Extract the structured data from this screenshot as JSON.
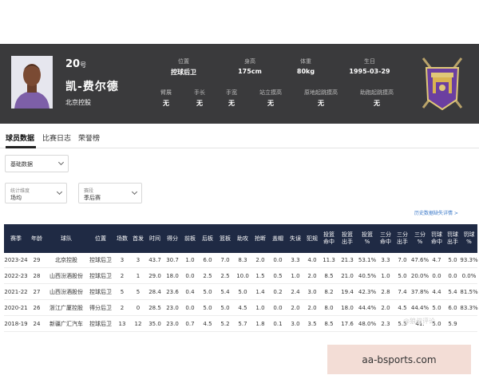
{
  "player": {
    "number": "20",
    "number_suffix": "号",
    "name": "凯-费尔德",
    "team": "北京控股",
    "info_row1": [
      {
        "label": "位置",
        "value": "控球后卫"
      },
      {
        "label": "身高",
        "value": "175cm"
      },
      {
        "label": "体重",
        "value": "80kg"
      },
      {
        "label": "生日",
        "value": "1995-03-29"
      }
    ],
    "info_row2": [
      {
        "label": "臂展",
        "value": "无"
      },
      {
        "label": "手长",
        "value": "无"
      },
      {
        "label": "手宽",
        "value": "无"
      },
      {
        "label": "站立摸高",
        "value": "无"
      },
      {
        "label": "原地起跳摸高",
        "value": "无"
      },
      {
        "label": "助跑起跳摸高",
        "value": "无"
      }
    ]
  },
  "tabs": [
    {
      "label": "球员数据",
      "active": true
    },
    {
      "label": "比赛日志",
      "active": false
    },
    {
      "label": "荣誉榜",
      "active": false
    }
  ],
  "filters": {
    "data_type": {
      "value": "基础数据"
    },
    "stat_dim": {
      "label": "统计维度",
      "value": "场均"
    },
    "season_type": {
      "label": "赛段",
      "value": "季后赛"
    }
  },
  "history_link": "历史数据缺失详情 >",
  "table": {
    "headers": [
      "赛季",
      "年龄",
      "球队",
      "位置",
      "场数",
      "首发",
      "时间",
      "得分",
      "前板",
      "后板",
      "篮板",
      "助攻",
      "抢断",
      "盖帽",
      "失误",
      "犯规",
      "投篮\n命中",
      "投篮\n出手",
      "投篮\n%",
      "三分\n命中",
      "三分\n出手",
      "三分\n%",
      "罚球\n命中",
      "罚球\n出手",
      "罚球\n%"
    ],
    "rows": [
      [
        "2023-24",
        "29",
        "北京控股",
        "控球后卫",
        "3",
        "3",
        "43.7",
        "30.7",
        "1.0",
        "6.0",
        "7.0",
        "8.3",
        "2.0",
        "0.0",
        "3.3",
        "4.0",
        "11.3",
        "21.3",
        "53.1%",
        "3.3",
        "7.0",
        "47.6%",
        "4.7",
        "5.0",
        "93.3%"
      ],
      [
        "2022-23",
        "28",
        "山西汾酒股份",
        "控球后卫",
        "2",
        "1",
        "29.0",
        "18.0",
        "0.0",
        "2.5",
        "2.5",
        "10.0",
        "1.5",
        "0.5",
        "1.0",
        "2.0",
        "8.5",
        "21.0",
        "40.5%",
        "1.0",
        "5.0",
        "20.0%",
        "0.0",
        "0.0",
        "0.0%"
      ],
      [
        "2021-22",
        "27",
        "山西汾酒股份",
        "控球后卫",
        "5",
        "5",
        "28.4",
        "23.6",
        "0.4",
        "5.0",
        "5.4",
        "5.0",
        "1.4",
        "0.2",
        "2.4",
        "3.0",
        "8.2",
        "19.4",
        "42.3%",
        "2.8",
        "7.4",
        "37.8%",
        "4.4",
        "5.4",
        "81.5%"
      ],
      [
        "2020-21",
        "26",
        "浙江广厦控股",
        "得分后卫",
        "2",
        "0",
        "28.5",
        "23.0",
        "0.0",
        "5.0",
        "5.0",
        "4.5",
        "1.0",
        "0.0",
        "2.0",
        "2.0",
        "8.0",
        "18.0",
        "44.4%",
        "2.0",
        "4.5",
        "44.4%",
        "5.0",
        "6.0",
        "83.3%"
      ],
      [
        "2018-19",
        "24",
        "新疆广汇汽车",
        "控球后卫",
        "13",
        "12",
        "35.0",
        "23.0",
        "0.7",
        "4.5",
        "5.2",
        "5.7",
        "1.8",
        "0.1",
        "3.0",
        "3.5",
        "8.5",
        "17.6",
        "48.0%",
        "2.3",
        "5.5",
        "41.",
        "5.0",
        "5.9",
        "",
        ""
      ]
    ]
  },
  "watermark": "@狼叔评论",
  "banner": "aa-bsports.com"
}
